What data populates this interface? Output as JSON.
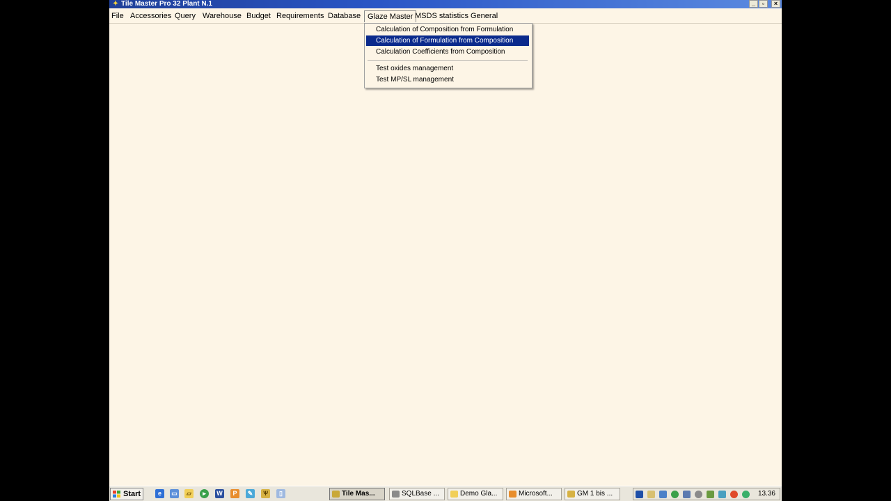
{
  "window": {
    "title": "Tile Master Pro 32  Plant N.1",
    "minimize_label": "_",
    "maximize_label": "▫",
    "close_label": "×"
  },
  "menubar": {
    "items": [
      {
        "label": "File"
      },
      {
        "label": "Accessories"
      },
      {
        "label": "Query"
      },
      {
        "label": "Warehouse"
      },
      {
        "label": "Budget"
      },
      {
        "label": "Requirements"
      },
      {
        "label": "Database"
      },
      {
        "label": "Glaze Master"
      },
      {
        "label": "MSDS statistics"
      },
      {
        "label": "General"
      }
    ],
    "open_menu": "Glaze Master"
  },
  "dropdown": {
    "items": [
      {
        "label": "Calculation of Composition from  Formulation"
      },
      {
        "label": "Calculation of Formulation from Composition",
        "highlighted": true
      },
      {
        "label": "Calculation Coefficients from Composition"
      },
      {
        "label": "Test oxides management"
      },
      {
        "label": "Test MP/SL management"
      }
    ]
  },
  "taskbar": {
    "start_label": "Start",
    "tasks": [
      {
        "label": "Tile Mas...",
        "active": true
      },
      {
        "label": "SQLBase ..."
      },
      {
        "label": "Demo Gla..."
      },
      {
        "label": "Microsoft..."
      },
      {
        "label": "GM 1 bis ..."
      }
    ],
    "clock": "13.36"
  },
  "colors": {
    "workspace": "#fdf5e6",
    "menu_highlight": "#0a2a8c",
    "titlebar": "#2a56c6"
  }
}
